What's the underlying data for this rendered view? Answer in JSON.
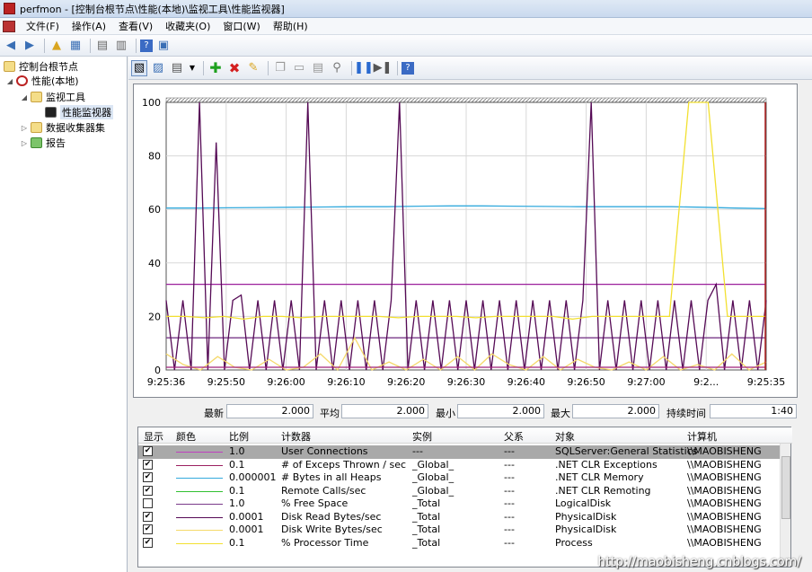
{
  "window": {
    "title": "perfmon - [控制台根节点\\性能(本地)\\监视工具\\性能监视器]"
  },
  "menu": [
    "文件(F)",
    "操作(A)",
    "查看(V)",
    "收藏夹(O)",
    "窗口(W)",
    "帮助(H)"
  ],
  "tree": {
    "root": "控制台根节点",
    "perf": "性能(本地)",
    "monitor_tools": "监视工具",
    "perf_monitor": "性能监视器",
    "collector_sets": "数据收集器集",
    "reports": "报告"
  },
  "chart_data": {
    "type": "line",
    "ylim": [
      0,
      100
    ],
    "y_ticks": [
      "0",
      "20",
      "40",
      "60",
      "80",
      "100"
    ],
    "x_ticks": [
      "9:25:36",
      "9:25:50",
      "9:26:00",
      "9:26:10",
      "9:26:20",
      "9:26:30",
      "9:26:40",
      "9:26:50",
      "9:27:00",
      "9:2...",
      "9:25:35"
    ],
    "grid": true,
    "series": [
      {
        "name": "User Connections",
        "color": "#9b1f9b",
        "values": [
          32,
          32,
          32,
          32,
          32,
          32,
          32,
          32,
          32,
          32,
          32,
          32,
          32,
          32,
          32,
          32,
          32,
          32,
          32,
          32
        ]
      },
      {
        "name": "# Bytes in all Heaps",
        "color": "#33aadd",
        "values": [
          60.5,
          60.5,
          60.6,
          60.7,
          60.8,
          60.9,
          61,
          61,
          61.2,
          61.3,
          61.3,
          61.2,
          61.1,
          61,
          61,
          61,
          61,
          60.8,
          60.5,
          60.3
        ]
      },
      {
        "name": "% Free Space",
        "color": "#7a3a8a",
        "values": [
          12,
          12,
          12,
          12,
          12,
          12,
          12,
          12,
          12,
          12,
          12,
          12,
          12,
          12,
          12,
          12,
          12,
          12,
          12,
          12
        ]
      },
      {
        "name": "Disk Read Bytes/sec",
        "color": "#550a55",
        "values": [
          26,
          0,
          26,
          0,
          100,
          0,
          85,
          0,
          26,
          28,
          0,
          26,
          0,
          26,
          0,
          26,
          0,
          100,
          0,
          26,
          0,
          26,
          0,
          26,
          0,
          26,
          0,
          26,
          100,
          0,
          26,
          0,
          26,
          0,
          26,
          0,
          26,
          0,
          26,
          0,
          26,
          0,
          26,
          0,
          26,
          0,
          26,
          0,
          26,
          0,
          26,
          100,
          0,
          26,
          0,
          26,
          0,
          26,
          0,
          26,
          0,
          26,
          0,
          26,
          0,
          26,
          32,
          0,
          26,
          0,
          26,
          0,
          26
        ]
      },
      {
        "name": "% Processor Time",
        "color": "#f2e030",
        "values": [
          20,
          20,
          19.5,
          20,
          19,
          20,
          20,
          19.5,
          20,
          20,
          20,
          20,
          19.5,
          20,
          20,
          20,
          19.5,
          20,
          20,
          20,
          20,
          19,
          20,
          20,
          20,
          20,
          20,
          100,
          100,
          20,
          20,
          20
        ]
      },
      {
        "name": "Disk Write Bytes/sec",
        "color": "#f5d96a",
        "values": [
          6,
          2,
          0,
          5,
          1,
          0,
          4,
          0,
          1,
          6,
          0,
          12,
          0,
          3,
          0,
          4,
          0,
          5,
          0,
          6,
          2,
          0,
          5,
          0,
          4,
          1,
          0,
          3,
          0,
          5,
          0,
          2,
          0,
          6,
          0,
          3
        ]
      },
      {
        "name": "# of Exceps Thrown / sec",
        "color": "#a0207a",
        "values": [
          1,
          1,
          1,
          1,
          1,
          1,
          1,
          1,
          1,
          1,
          1,
          1,
          1,
          1,
          1,
          1,
          1,
          1,
          1,
          1
        ]
      }
    ]
  },
  "stats": {
    "last_label": "最新",
    "last_value": "2.000",
    "avg_label": "平均",
    "avg_value": "2.000",
    "min_label": "最小",
    "min_value": "2.000",
    "max_label": "最大",
    "max_value": "2.000",
    "duration_label": "持续时间",
    "duration_value": "1:40"
  },
  "table": {
    "headers": [
      "显示",
      "颜色",
      "比例",
      "计数器",
      "实例",
      "父系",
      "对象",
      "计算机"
    ],
    "rows": [
      {
        "checked": true,
        "color": "#c040c0",
        "scale": "1.0",
        "counter": "User Connections",
        "instance": "---",
        "parent": "---",
        "object": "SQLServer:General Statistics",
        "computer": "\\\\MAOBISHENG",
        "selected": true
      },
      {
        "checked": true,
        "color": "#9b2060",
        "scale": "0.1",
        "counter": "# of Exceps Thrown / sec",
        "instance": "_Global_",
        "parent": "---",
        "object": ".NET CLR Exceptions",
        "computer": "\\\\MAOBISHENG"
      },
      {
        "checked": true,
        "color": "#33aadd",
        "scale": "0.000001",
        "counter": "# Bytes in all Heaps",
        "instance": "_Global_",
        "parent": "---",
        "object": ".NET CLR Memory",
        "computer": "\\\\MAOBISHENG"
      },
      {
        "checked": true,
        "color": "#30c030",
        "scale": "0.1",
        "counter": "Remote Calls/sec",
        "instance": "_Global_",
        "parent": "---",
        "object": ".NET CLR Remoting",
        "computer": "\\\\MAOBISHENG"
      },
      {
        "checked": false,
        "color": "#7a3a8a",
        "scale": "1.0",
        "counter": "% Free Space",
        "instance": "_Total",
        "parent": "---",
        "object": "LogicalDisk",
        "computer": "\\\\MAOBISHENG"
      },
      {
        "checked": true,
        "color": "#550a55",
        "scale": "0.0001",
        "counter": "Disk Read Bytes/sec",
        "instance": "_Total",
        "parent": "---",
        "object": "PhysicalDisk",
        "computer": "\\\\MAOBISHENG"
      },
      {
        "checked": true,
        "color": "#f5d96a",
        "scale": "0.0001",
        "counter": "Disk Write Bytes/sec",
        "instance": "_Total",
        "parent": "---",
        "object": "PhysicalDisk",
        "computer": "\\\\MAOBISHENG"
      },
      {
        "checked": true,
        "color": "#f2e030",
        "scale": "0.1",
        "counter": "% Processor Time",
        "instance": "_Total",
        "parent": "---",
        "object": "Process",
        "computer": "\\\\MAOBISHENG"
      }
    ]
  },
  "watermark": "http://maobisheng.cnblogs.com/"
}
